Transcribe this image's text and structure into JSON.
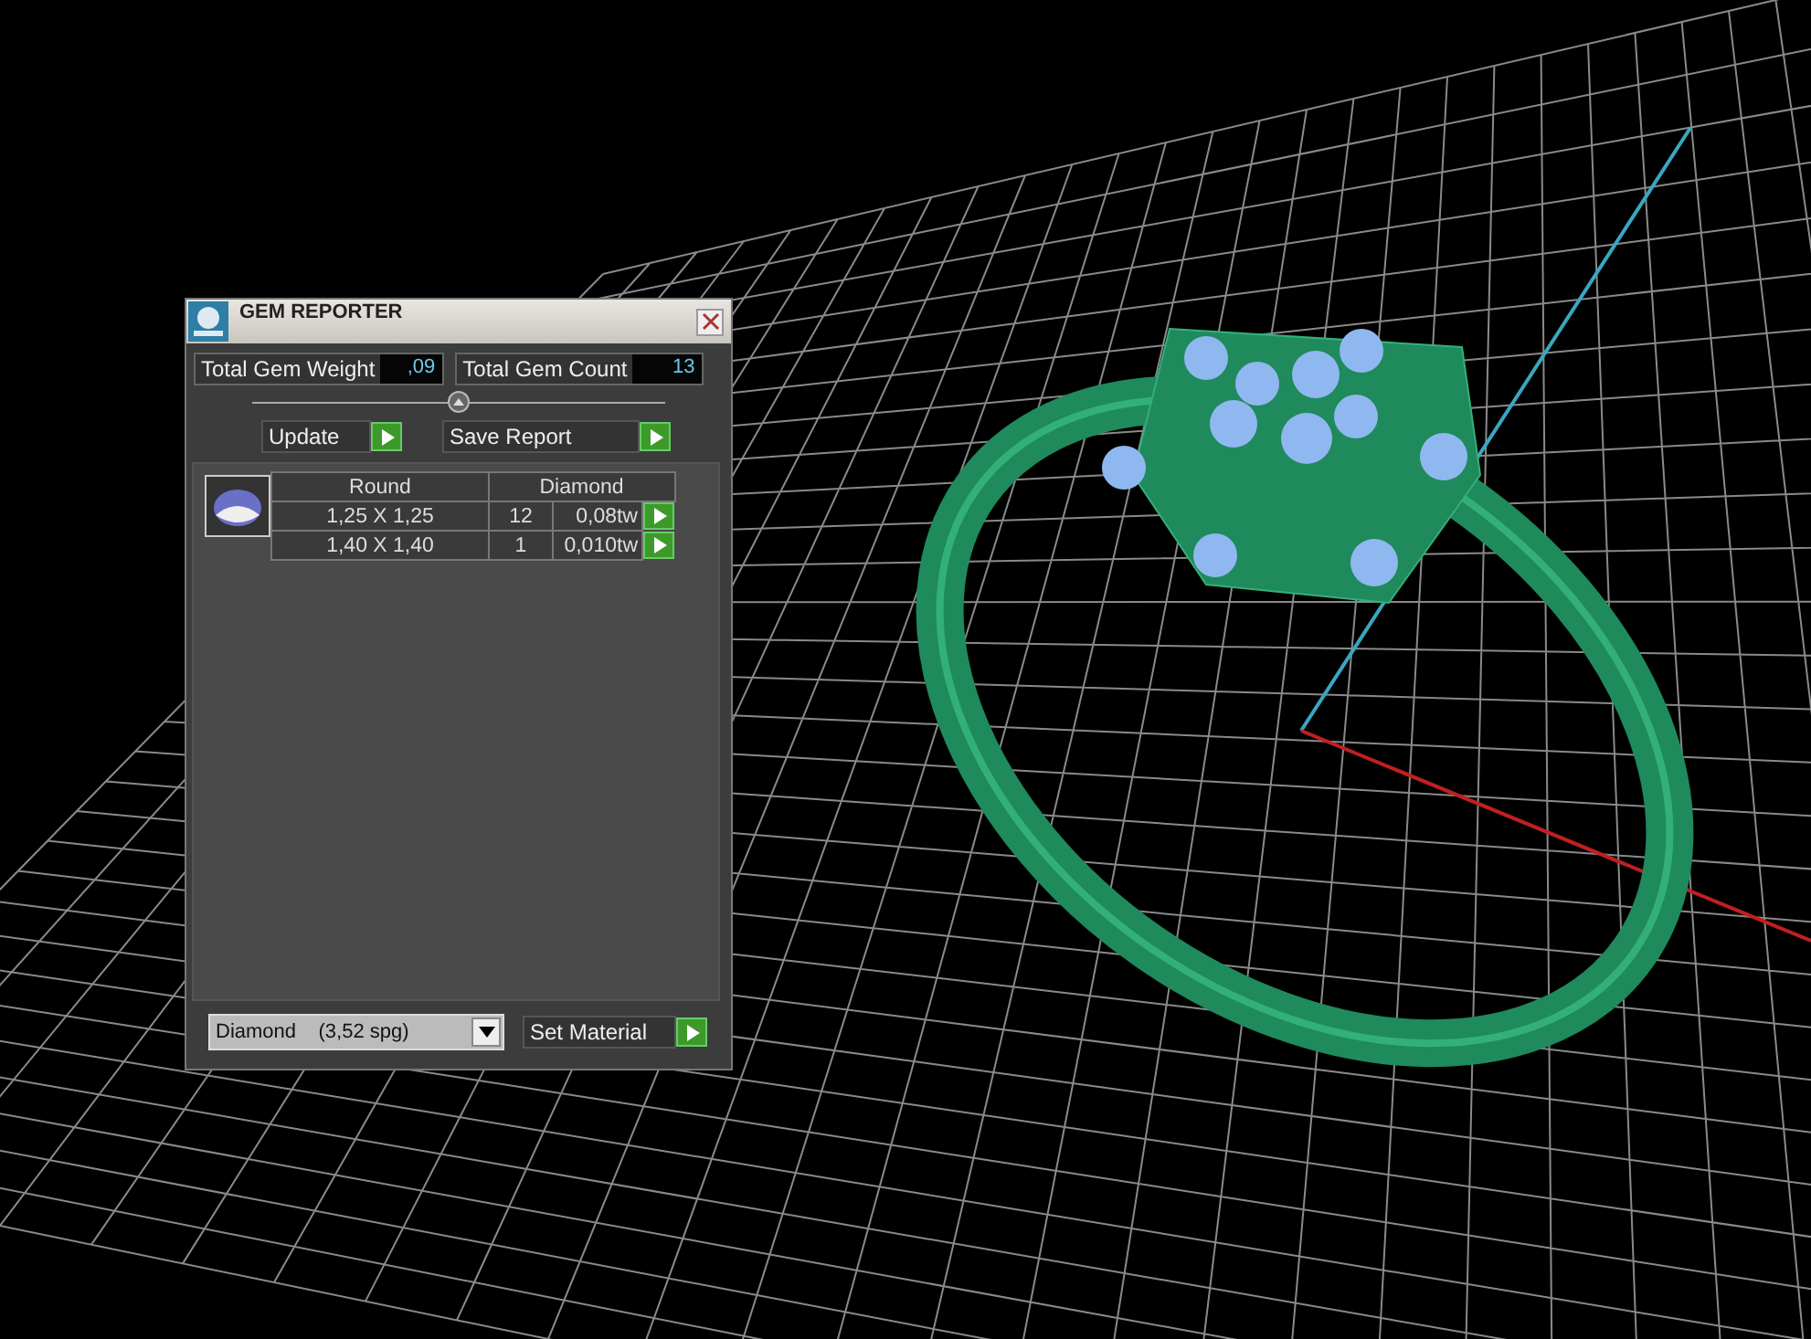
{
  "window": {
    "title": "GEM REPORTER"
  },
  "stats": [
    {
      "label": "Total Gem Weight",
      "value": ",09"
    },
    {
      "label": "Total Gem Count",
      "value": "13"
    }
  ],
  "buttons": [
    {
      "label": "Update"
    },
    {
      "label": "Save Report"
    }
  ],
  "table": {
    "columns": [
      "Round",
      "Diamond"
    ],
    "rows": [
      {
        "size": "1,25 X 1,25",
        "count": "12",
        "weight": "0,08tw"
      },
      {
        "size": "1,40 X 1,40",
        "count": "1",
        "weight": "0,010tw"
      }
    ]
  },
  "material": {
    "value": "Diamond    (3,52 spg)"
  },
  "set_material": {
    "label": "Set Material"
  }
}
